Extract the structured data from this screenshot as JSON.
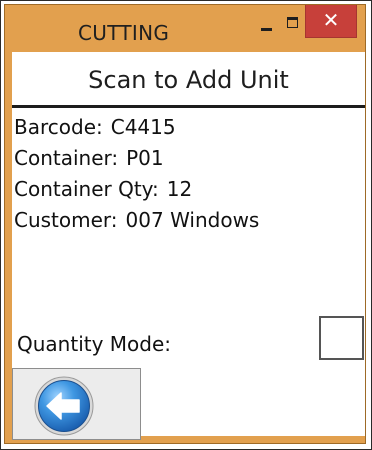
{
  "window": {
    "title": "CUTTING",
    "controls": {
      "minimize_icon": "minimize-icon",
      "maximize_icon": "maximize-icon",
      "close_glyph": "✕"
    }
  },
  "header": {
    "title": "Scan to Add Unit"
  },
  "info": [
    {
      "label": "Barcode:",
      "value": "C4415"
    },
    {
      "label": "Container:",
      "value": "P01"
    },
    {
      "label": "Container Qty:",
      "value": "12"
    },
    {
      "label": "Customer:",
      "value": "007 Windows"
    }
  ],
  "quantity_mode": {
    "label": "Quantity Mode:",
    "checked": false
  },
  "back_button": {
    "icon": "back-arrow-icon"
  },
  "colors": {
    "title_bar": "#e2a04e",
    "close_button": "#c7403a",
    "back_circle": "#2f86d6"
  }
}
